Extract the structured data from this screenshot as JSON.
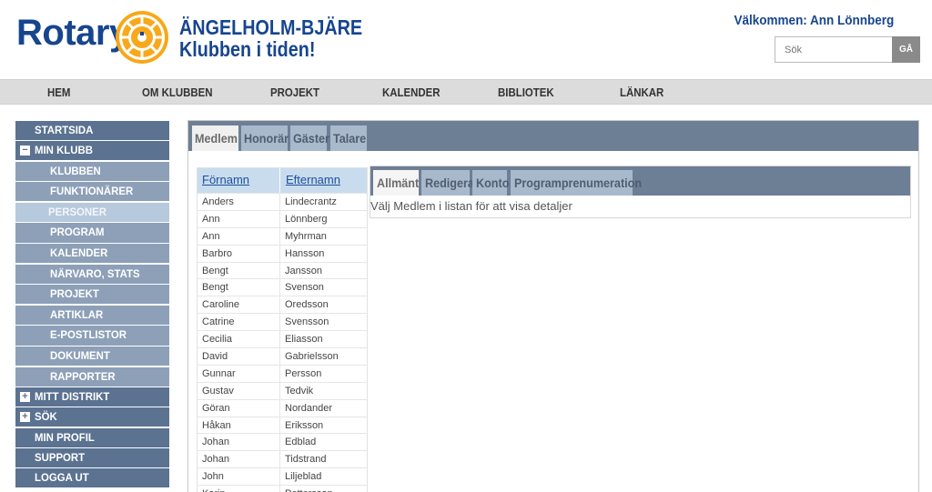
{
  "header": {
    "logo_text": "Rotary",
    "club_name_line1": "ÄNGELHOLM-BJÄRE",
    "club_name_line2": "Klubben i tiden!",
    "welcome": "Välkommen: Ann Lönnberg",
    "search_placeholder": "Sök",
    "search_button": "GÅ",
    "brand_color": "#17458f",
    "wheel_color": "#f7a81b"
  },
  "topnav": [
    "HEM",
    "OM KLUBBEN",
    "PROJEKT",
    "KALENDER",
    "BIBLIOTEK",
    "LÄNKAR"
  ],
  "sidebar": {
    "items": [
      {
        "label": "STARTSIDA"
      },
      {
        "label": "MIN KLUBB",
        "toggle": "−"
      },
      {
        "label": "KLUBBEN"
      },
      {
        "label": "FUNKTIONÄRER"
      },
      {
        "label": "PERSONER"
      },
      {
        "label": "PROGRAM"
      },
      {
        "label": "KALENDER"
      },
      {
        "label": "NÄRVARO, STATS"
      },
      {
        "label": "PROJEKT"
      },
      {
        "label": "ARTIKLAR"
      },
      {
        "label": "E-POSTLISTOR"
      },
      {
        "label": "DOKUMENT"
      },
      {
        "label": "RAPPORTER"
      },
      {
        "label": "MITT DISTRIKT",
        "toggle": "+"
      },
      {
        "label": "SÖK",
        "toggle": "+"
      },
      {
        "label": "MIN PROFIL"
      },
      {
        "label": "SUPPORT"
      },
      {
        "label": "LOGGA UT"
      }
    ]
  },
  "outer_tabs": [
    "Medlem",
    "Honorär",
    "Gäster",
    "Talare"
  ],
  "member_list": {
    "headers": {
      "first": "Förnamn",
      "last": "Efternamn"
    },
    "rows": [
      {
        "first": "Anders",
        "last": "Lindecrantz"
      },
      {
        "first": "Ann",
        "last": "Lönnberg"
      },
      {
        "first": "Ann",
        "last": "Myhrman"
      },
      {
        "first": "Barbro",
        "last": "Hansson"
      },
      {
        "first": "Bengt",
        "last": "Jansson"
      },
      {
        "first": "Bengt",
        "last": "Svenson"
      },
      {
        "first": "Caroline",
        "last": "Oredsson"
      },
      {
        "first": "Catrine",
        "last": "Svensson"
      },
      {
        "first": "Cecilia",
        "last": "Eliasson"
      },
      {
        "first": "David",
        "last": "Gabrielsson"
      },
      {
        "first": "Gunnar",
        "last": "Persson"
      },
      {
        "first": "Gustav",
        "last": "Tedvik"
      },
      {
        "first": "Göran",
        "last": "Nordander"
      },
      {
        "first": "Håkan",
        "last": "Eriksson"
      },
      {
        "first": "Johan",
        "last": "Edblad"
      },
      {
        "first": "Johan",
        "last": "Tidstrand"
      },
      {
        "first": "John",
        "last": "Liljeblad"
      },
      {
        "first": "Karin",
        "last": "Pettersson"
      }
    ]
  },
  "detail": {
    "tabs": [
      "Allmänt",
      "Redigera",
      "Konto",
      "Programprenumeration"
    ],
    "message": "Välj Medlem i listan för att visa detaljer"
  }
}
